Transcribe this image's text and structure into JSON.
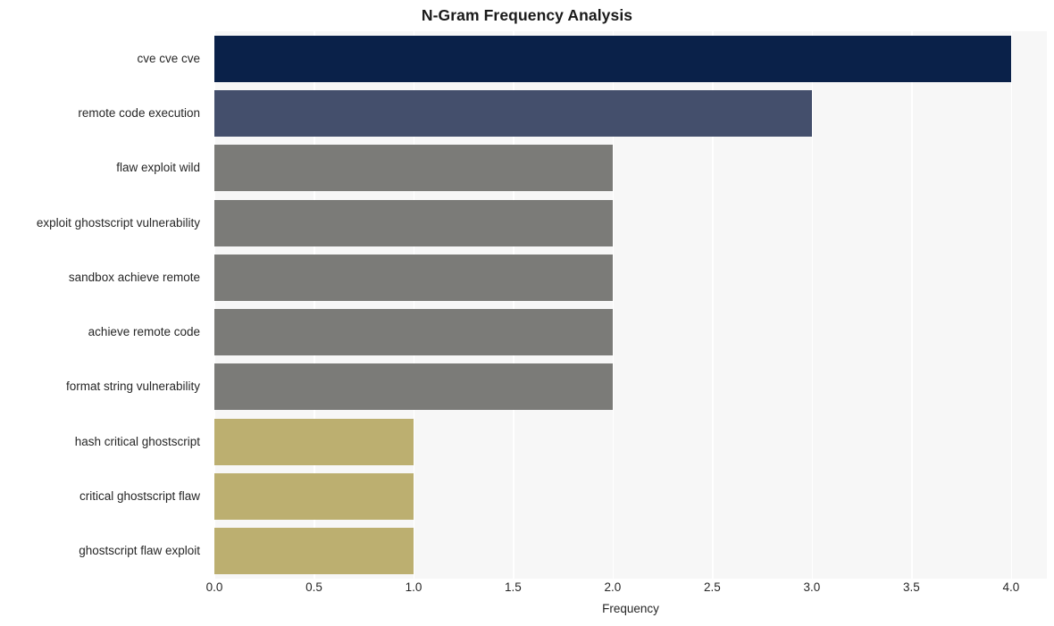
{
  "chart_data": {
    "type": "bar",
    "orientation": "horizontal",
    "title": "N-Gram Frequency Analysis",
    "xlabel": "Frequency",
    "ylabel": "",
    "categories": [
      "cve cve cve",
      "remote code execution",
      "flaw exploit wild",
      "exploit ghostscript vulnerability",
      "sandbox achieve remote",
      "achieve remote code",
      "format string vulnerability",
      "hash critical ghostscript",
      "critical ghostscript flaw",
      "ghostscript flaw exploit"
    ],
    "values": [
      4,
      3,
      2,
      2,
      2,
      2,
      2,
      1,
      1,
      1
    ],
    "bar_colors": [
      "#0a2149",
      "#444f6c",
      "#7b7b78",
      "#7b7b78",
      "#7b7b78",
      "#7b7b78",
      "#7b7b78",
      "#bcaf70",
      "#bcaf70",
      "#bcaf70"
    ],
    "xlim": [
      0,
      4.18
    ],
    "xticks": [
      0,
      0.5,
      1,
      1.5,
      2,
      2.5,
      3,
      3.5,
      4
    ],
    "xticklabels": [
      "0.0",
      "0.5",
      "1.0",
      "1.5",
      "2.0",
      "2.5",
      "3.0",
      "3.5",
      "4.0"
    ],
    "grid": true,
    "grid_axis": "x",
    "legend": false,
    "style": {
      "plot_background": "#f7f7f7",
      "figure_background": "#ffffff",
      "gridline_color": "#ffffff",
      "tick_label_color": "#262626",
      "title_color": "#1a1a1a"
    }
  }
}
